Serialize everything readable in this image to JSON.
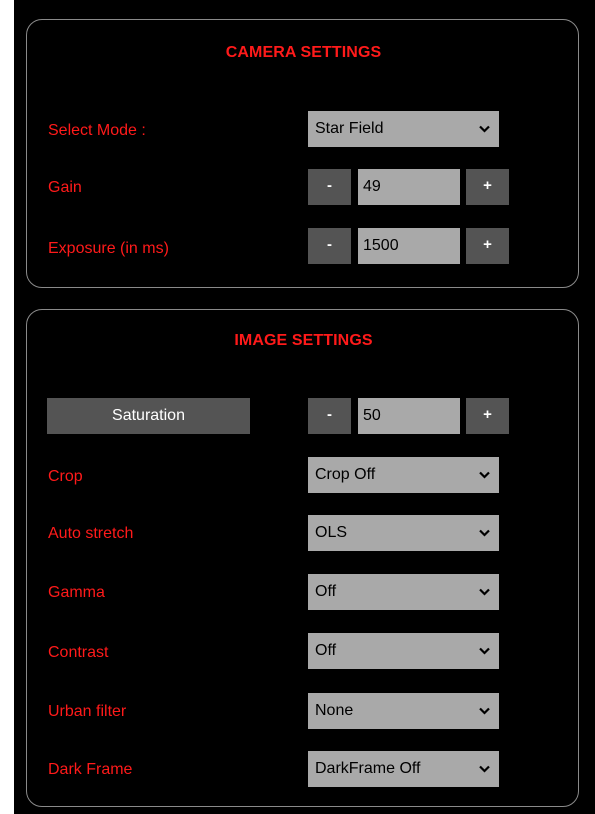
{
  "camera_settings": {
    "title": "CAMERA SETTINGS",
    "select_mode": {
      "label": "Select Mode :",
      "value": "Star Field"
    },
    "gain": {
      "label": "Gain",
      "minus": "-",
      "value": "49",
      "plus": "+"
    },
    "exposure": {
      "label": "Exposure (in ms)",
      "minus": "-",
      "value": "1500",
      "plus": "+"
    }
  },
  "image_settings": {
    "title": "IMAGE SETTINGS",
    "saturation": {
      "label": "Saturation",
      "minus": "-",
      "value": "50",
      "plus": "+"
    },
    "crop": {
      "label": "Crop",
      "value": "Crop Off"
    },
    "auto_stretch": {
      "label": "Auto stretch",
      "value": "OLS"
    },
    "gamma": {
      "label": "Gamma",
      "value": "Off"
    },
    "contrast": {
      "label": "Contrast",
      "value": "Off"
    },
    "urban_filter": {
      "label": "Urban filter",
      "value": "None"
    },
    "dark_frame": {
      "label": "Dark Frame",
      "value": "DarkFrame Off"
    }
  },
  "colors": {
    "background": "#000000",
    "label_red": "#ff1a1a",
    "control_grey": "#a9a9a9",
    "button_dark_grey": "#545454",
    "panel_border": "#8a8a8a"
  }
}
